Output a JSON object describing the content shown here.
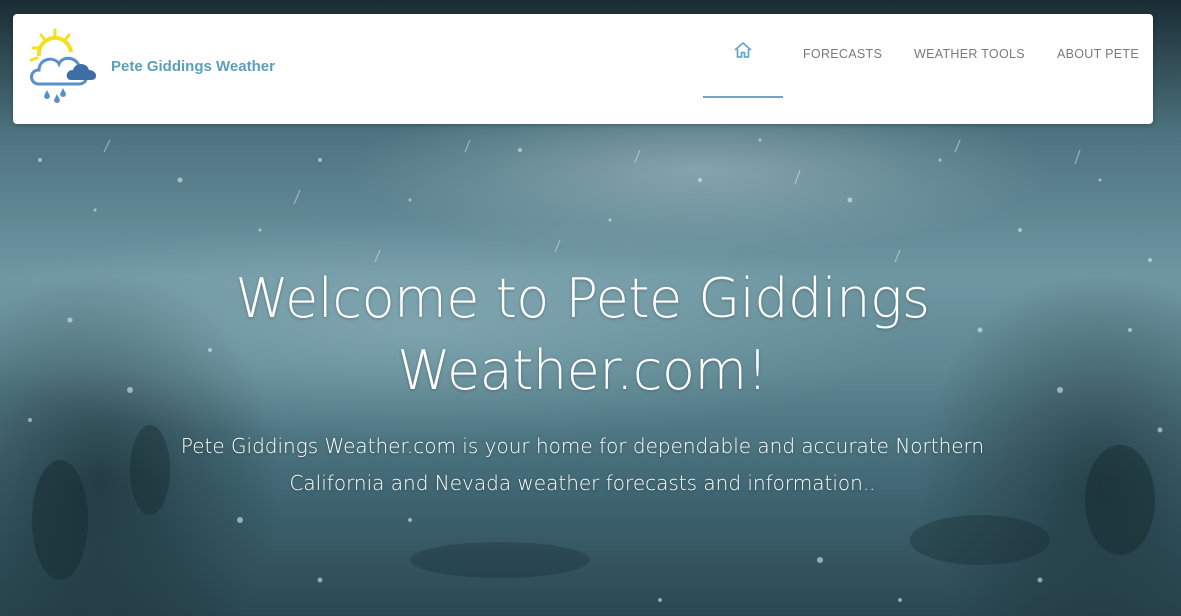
{
  "brand": {
    "name": "Pete Giddings Weather",
    "logo_icon": "sun-cloud-rain-icon"
  },
  "nav": {
    "home_icon": "home-icon",
    "items": [
      {
        "label": "FORECASTS"
      },
      {
        "label": "WEATHER TOOLS"
      },
      {
        "label": "ABOUT PETE"
      }
    ],
    "active": "home"
  },
  "hero": {
    "headline": "Welcome to Pete Giddings Weather.com!",
    "subheadline": "Pete Giddings Weather.com is your home for dependable and accurate Northern California and Nevada weather forecasts and information.."
  },
  "colors": {
    "brand": "#5b9fbd",
    "nav_text": "#7a7a7a",
    "active_underline": "#6aa8c8",
    "sun": "#f2e21c",
    "cloud_dark": "#3d6fa6"
  }
}
